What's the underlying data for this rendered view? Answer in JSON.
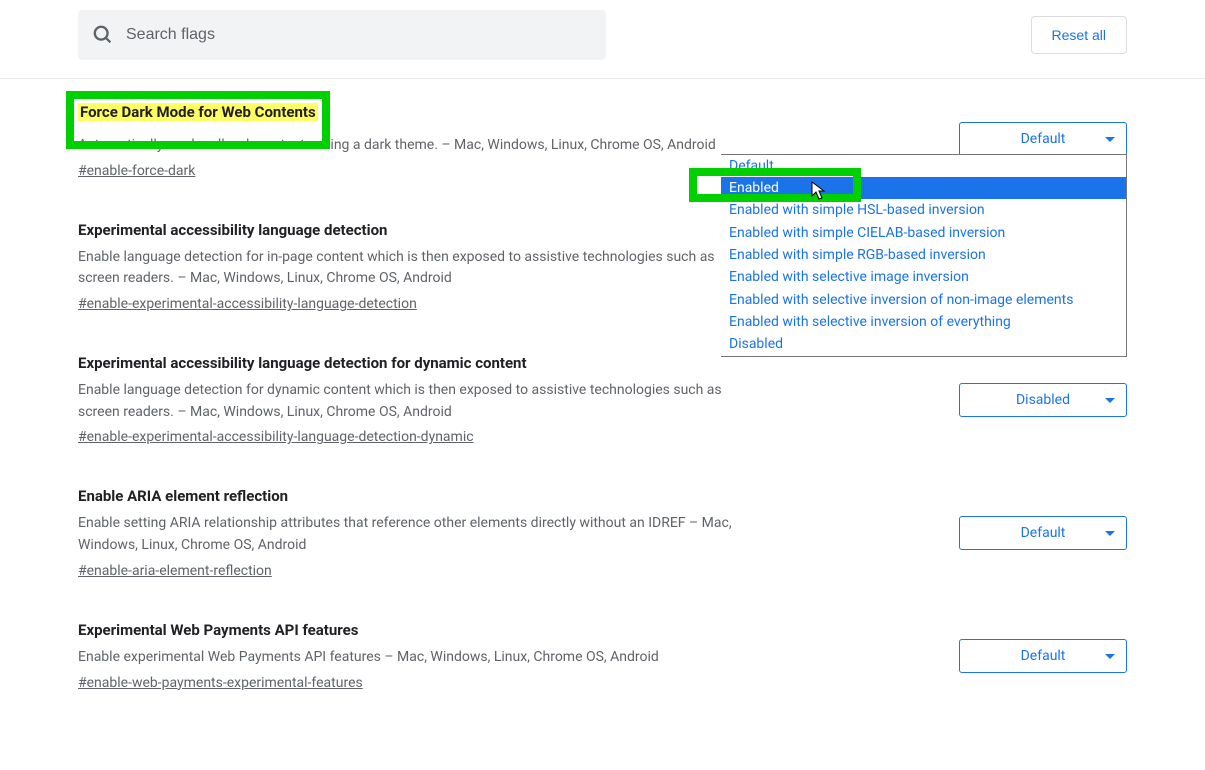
{
  "search": {
    "placeholder": "Search flags"
  },
  "reset_button": "Reset all",
  "flags": [
    {
      "title": "Force Dark Mode for Web Contents",
      "description": "Automatically render all web contents using a dark theme. – Mac, Windows, Linux, Chrome OS, Android",
      "hash": "#enable-force-dark",
      "select_value": "Default",
      "dropdown_open": true
    },
    {
      "title": "Experimental accessibility language detection",
      "description": "Enable language detection for in-page content which is then exposed to assistive technologies such as screen readers. – Mac, Windows, Linux, Chrome OS, Android",
      "hash": "#enable-experimental-accessibility-language-detection",
      "select_value": ""
    },
    {
      "title": "Experimental accessibility language detection for dynamic content",
      "description": "Enable language detection for dynamic content which is then exposed to assistive technologies such as screen readers. – Mac, Windows, Linux, Chrome OS, Android",
      "hash": "#enable-experimental-accessibility-language-detection-dynamic",
      "select_value": "Disabled"
    },
    {
      "title": "Enable ARIA element reflection",
      "description": "Enable setting ARIA relationship attributes that reference other elements directly without an IDREF – Mac, Windows, Linux, Chrome OS, Android",
      "hash": "#enable-aria-element-reflection",
      "select_value": "Default"
    },
    {
      "title": "Experimental Web Payments API features",
      "description": "Enable experimental Web Payments API features – Mac, Windows, Linux, Chrome OS, Android",
      "hash": "#enable-web-payments-experimental-features",
      "select_value": "Default"
    }
  ],
  "dropdown_options": [
    "Default",
    "Enabled",
    "Enabled with simple HSL-based inversion",
    "Enabled with simple CIELAB-based inversion",
    "Enabled with simple RGB-based inversion",
    "Enabled with selective image inversion",
    "Enabled with selective inversion of non-image elements",
    "Enabled with selective inversion of everything",
    "Disabled"
  ],
  "dropdown_selected_index": 1
}
